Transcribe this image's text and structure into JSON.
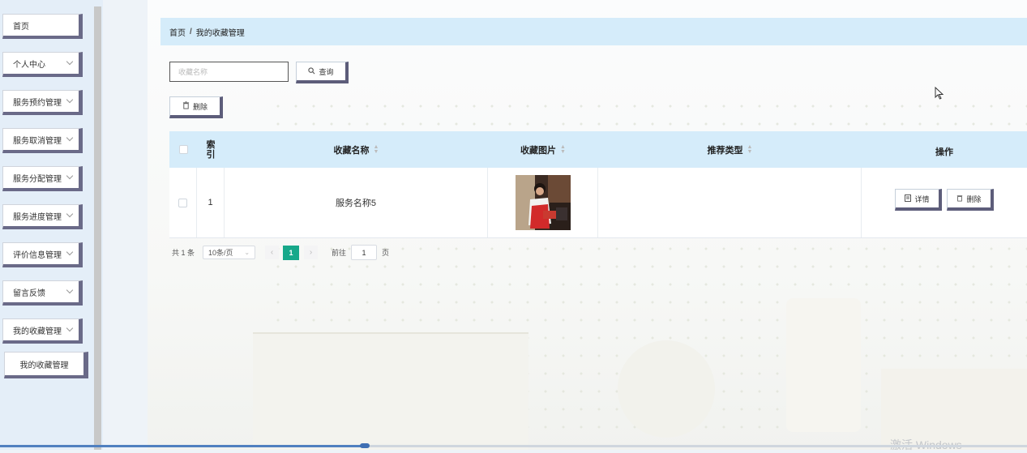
{
  "sidebar": {
    "items": [
      {
        "label": "首页",
        "has_chevron": false
      },
      {
        "label": "个人中心",
        "has_chevron": true
      },
      {
        "label": "服务预约管理",
        "has_chevron": true
      },
      {
        "label": "服务取消管理",
        "has_chevron": true
      },
      {
        "label": "服务分配管理",
        "has_chevron": true
      },
      {
        "label": "服务进度管理",
        "has_chevron": true
      },
      {
        "label": "评价信息管理",
        "has_chevron": true
      },
      {
        "label": "留言反馈",
        "has_chevron": true
      },
      {
        "label": "我的收藏管理",
        "has_chevron": true
      }
    ],
    "sub_item": "我的收藏管理"
  },
  "breadcrumb": {
    "home": "首页",
    "separator": "/",
    "current": "我的收藏管理"
  },
  "search": {
    "placeholder": "收藏名称",
    "query_button": "查询"
  },
  "toolbar": {
    "delete_button": "删除"
  },
  "table": {
    "columns": {
      "index": "索引",
      "name": "收藏名称",
      "image": "收藏图片",
      "type": "推荐类型",
      "actions": "操作"
    },
    "rows": [
      {
        "index": "1",
        "name": "服务名称5",
        "type": "",
        "detail_button": "详情",
        "delete_button": "删除"
      }
    ]
  },
  "pagination": {
    "total": "共 1 条",
    "page_size": "10条/页",
    "current_page": "1",
    "goto_label": "前往",
    "goto_value": "1",
    "page_unit": "页"
  },
  "watermark": "激活 Windows",
  "colors": {
    "header_bg": "#d5ecfa",
    "accent": "#17a88a",
    "button_shadow": "#5d5d7a"
  }
}
